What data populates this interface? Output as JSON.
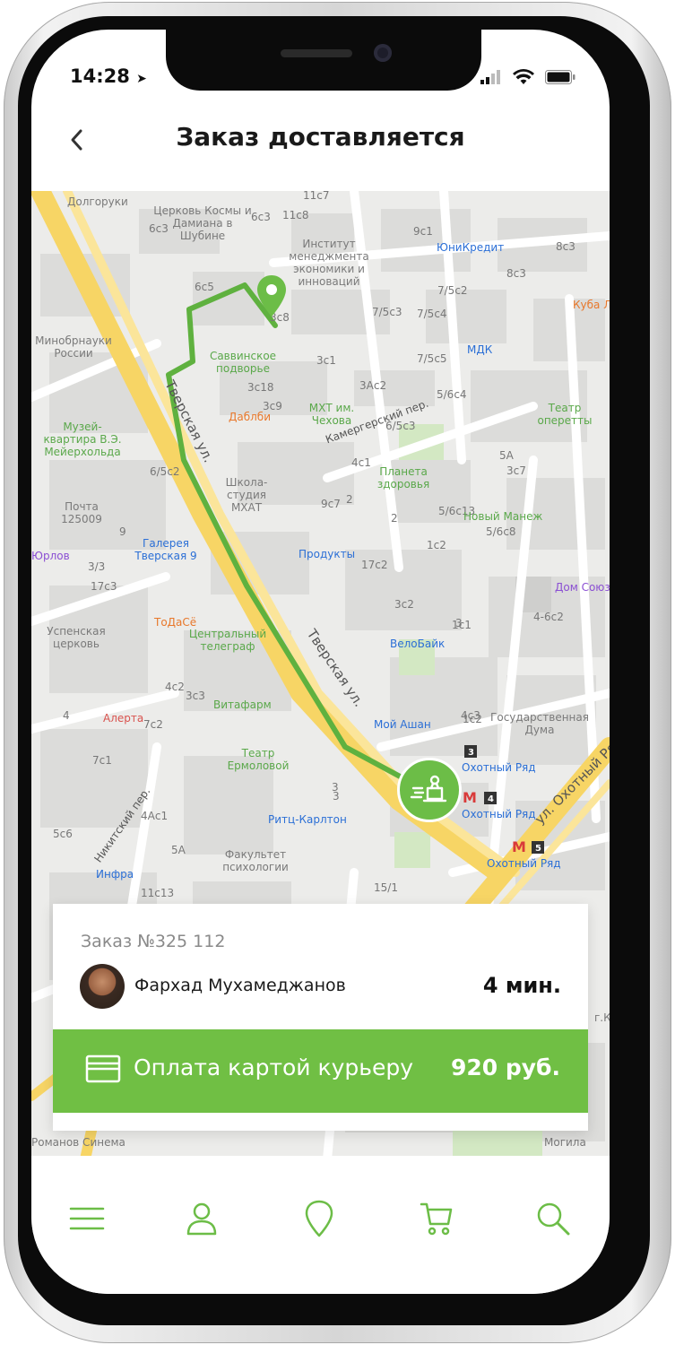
{
  "status_bar": {
    "time": "14:28"
  },
  "header": {
    "title": "Заказ доставляется"
  },
  "map": {
    "streets": [
      "Тверская ул.",
      "Тверская ул.",
      "Камергерский пер.",
      "ул. Охотный Ряд",
      "Никитский пер."
    ],
    "houses": [
      "11с7",
      "6с3",
      "11с8",
      "9с1",
      "6с5",
      "8с3",
      "3с8",
      "3с1",
      "7/5с3",
      "7/5с4",
      "7/5с2",
      "7/5с5",
      "3с18",
      "3с9",
      "3Ас2",
      "5/6с4",
      "4с1",
      "6/5с3",
      "5А",
      "3с7",
      "6/5с2",
      "9",
      "9с7",
      "2",
      "5/6с13",
      "5/6с8",
      "3/3",
      "17с3",
      "17с2",
      "1с2",
      "3с2",
      "1с1",
      "2",
      "4с3",
      "4с2",
      "3",
      "5с6",
      "4Ас1",
      "5А",
      "11с13",
      "15/1",
      "1с2",
      "7с2",
      "7с1",
      "4",
      "3",
      "3с3",
      "4-6с2",
      "3",
      "6с3",
      "8с3"
    ],
    "pois": [
      {
        "name": "Церковь Космы и Дамиана в Шубине",
        "color": "poi"
      },
      {
        "name": "Долгоруки",
        "color": "poi"
      },
      {
        "name": "Институт менеджмента экономики и инноваций",
        "color": "poi"
      },
      {
        "name": "ЮниКредит",
        "color": "blue"
      },
      {
        "name": "Куба Л",
        "color": "orange"
      },
      {
        "name": "Минобрнауки России",
        "color": "poi"
      },
      {
        "name": "Саввинское подворье",
        "color": "green"
      },
      {
        "name": "МДК",
        "color": "blue"
      },
      {
        "name": "МХТ им. Чехова",
        "color": "green"
      },
      {
        "name": "Театр оперетты",
        "color": "green"
      },
      {
        "name": "Даблби",
        "color": "orange"
      },
      {
        "name": "Музей-квартира В.Э. Мейерхольда",
        "color": "green"
      },
      {
        "name": "Школа-студия МХАТ",
        "color": "poi"
      },
      {
        "name": "Планета здоровья",
        "color": "green"
      },
      {
        "name": "Почта 125009",
        "color": "poi"
      },
      {
        "name": "Новый Манеж",
        "color": "green"
      },
      {
        "name": "Галерея Тверская 9",
        "color": "blue"
      },
      {
        "name": "Продукты",
        "color": "blue"
      },
      {
        "name": "Дом Союзо",
        "color": "purple"
      },
      {
        "name": "Успенская церковь",
        "color": "poi"
      },
      {
        "name": "ТоДаСё",
        "color": "orange"
      },
      {
        "name": "Центральный телеграф",
        "color": "green"
      },
      {
        "name": "ВелоБайк",
        "color": "blue"
      },
      {
        "name": "Витафарм",
        "color": "green"
      },
      {
        "name": "Алерта",
        "color": "red"
      },
      {
        "name": "Мой Ашан",
        "color": "blue"
      },
      {
        "name": "Государственная Дума",
        "color": "poi"
      },
      {
        "name": "Театр Ермоловой",
        "color": "green"
      },
      {
        "name": "Охотный Ряд",
        "color": "blue"
      },
      {
        "name": "Охотный Ряд",
        "color": "blue"
      },
      {
        "name": "Охотный Ряд",
        "color": "blue"
      },
      {
        "name": "Ритц-Карлтон",
        "color": "blue"
      },
      {
        "name": "Инфра",
        "color": "blue"
      },
      {
        "name": "Факультет психологии",
        "color": "poi"
      },
      {
        "name": "Романов Синема",
        "color": "poi"
      },
      {
        "name": "Могила",
        "color": "poi"
      },
      {
        "name": "г.К",
        "color": "poi"
      },
      {
        "name": "Юрлов",
        "color": "purple"
      }
    ]
  },
  "order": {
    "number_label": "Заказ  №325 112",
    "courier_name": "Фархад Мухамеджанов",
    "eta": "4 мин.",
    "payment_label": "Оплата картой курьеру",
    "payment_amount": "920 руб."
  },
  "tab_bar": {
    "icons": [
      "menu-icon",
      "profile-icon",
      "location-icon",
      "cart-icon",
      "search-icon"
    ]
  },
  "colors": {
    "accent": "#70bf44",
    "route": "#5fb13f",
    "road": "#f9d56e"
  }
}
